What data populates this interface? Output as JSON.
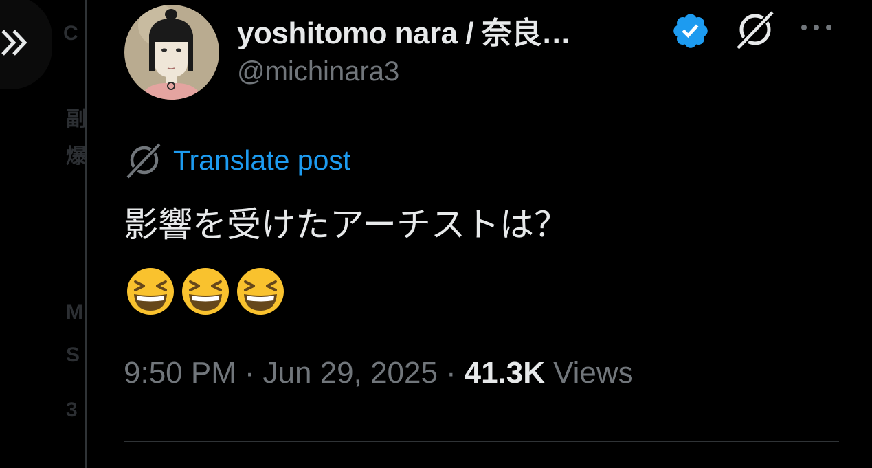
{
  "left_column": {
    "expand_icon": "double-chevron-right-icon",
    "ghost_text": [
      "C",
      "副",
      "爆",
      "M",
      "S",
      "3"
    ]
  },
  "tweet": {
    "author": {
      "display_name": "yoshitomo nara / 奈良…",
      "handle": "@michinara3",
      "verified": true
    },
    "translate_label": "Translate post",
    "text": "影響を受けたアーチストは？",
    "emojis": [
      "😆",
      "😆",
      "😆"
    ],
    "time": "9:50 PM",
    "date": "Jun 29, 2025",
    "separator": "·",
    "views_count": "41.3K",
    "views_label": "Views"
  },
  "colors": {
    "background": "#000000",
    "text": "#e7e9ea",
    "secondary": "#71767b",
    "accent": "#1d9bf0",
    "divider": "#2f3336"
  }
}
